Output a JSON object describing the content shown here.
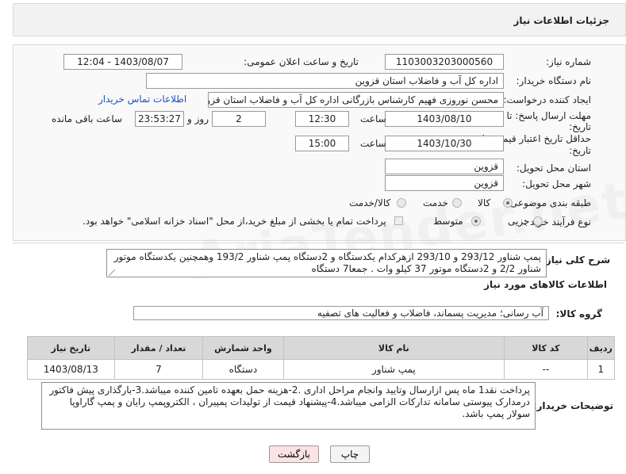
{
  "header": {
    "title": "جزئیات اطلاعات نیاز"
  },
  "form": {
    "need_number": {
      "label": "شماره نیاز:",
      "value": "1103003203000560"
    },
    "announce": {
      "label": "تاریخ و ساعت اعلان عمومی:",
      "value": "1403/08/07 - 12:04"
    },
    "buyer_org": {
      "label": "نام دستگاه خریدار:",
      "value": "اداره کل آب و فاضلاب استان قزوین"
    },
    "creator": {
      "label": "ایجاد کننده درخواست:",
      "value": "محسن نوروزی فهیم کارشناس بازرگانی اداره کل آب و فاضلاب استان قزوین",
      "contact_link": "اطلاعات تماس خریدار"
    },
    "deadline": {
      "label_line1": "مهلت ارسال پاسخ: تا",
      "label_line2": "تاریخ:",
      "date": "1403/08/10",
      "time_label": "ساعت",
      "time": "12:30",
      "days": "2",
      "days_label": "روز و",
      "remaining": "23:53:27",
      "remaining_label": "ساعت باقی مانده"
    },
    "price_validity": {
      "label_line1": "حداقل تاریخ اعتبار قیمت: تا",
      "label_line2": "تاریخ:",
      "date": "1403/10/30",
      "time_label": "ساعت",
      "time": "15:00"
    },
    "province": {
      "label": "استان محل تحویل:",
      "value": "قزوین"
    },
    "city": {
      "label": "شهر محل تحویل:",
      "value": "قزوین"
    },
    "category": {
      "label": "طبقه بندی موضوعی:",
      "options": [
        "کالا",
        "خدمت",
        "کالا/خدمت"
      ],
      "selected": "کالا"
    },
    "process": {
      "label": "نوع فرآیند خرید :",
      "options": [
        "جزیی",
        "متوسط"
      ],
      "selected": "متوسط",
      "payment_note": "پرداخت تمام یا بخشی از مبلغ خرید،از محل \"اسناد خزانه اسلامی\" خواهد بود."
    }
  },
  "summary": {
    "label": "شرح کلی نیاز:",
    "text": "پمپ شناور 293/12 و 293/10 ازهرکدام یکدستگاه و 2دستگاه پمپ شناور 193/2 وهمچنین یکدستگاه موتور شناور 2/2 و 2دستگاه موتور 37 کیلو وات . جمعا7 دستگاه"
  },
  "goods_section": {
    "title": "اطلاعات کالاهای مورد نیاز",
    "group_label": "گروه کالا:",
    "group_value": "آب رسانی؛ مدیریت پسماند، فاضلاب و فعالیت های تصفیه"
  },
  "table": {
    "headers": [
      "ردیف",
      "کد کالا",
      "نام کالا",
      "واحد شمارش",
      "تعداد / مقدار",
      "تاریخ نیاز"
    ],
    "rows": [
      [
        "1",
        "--",
        "پمپ شناور",
        "دستگاه",
        "7",
        "1403/08/13"
      ]
    ]
  },
  "buyer_notes": {
    "label": "توضیحات خریدار:",
    "text": "پرداخت نقد1 ماه پس ازارسال وتایید وانجام مراحل اداری .2-هزینه حمل بعهده تامین کننده میباشد.3-بارگذاری پیش فاکتور درمدارک پیوستی سامانه تدارکات الزامی میباشد.4-پیشنهاد قیمت از تولیدات  پمپیران ، الکتروپمپ رایان و پمپ گاراوپا سولار پمپ باشد."
  },
  "buttons": {
    "print": "چاپ",
    "back": "بازگشت"
  },
  "watermark": "AriaTender.net",
  "colors": {
    "link": "#1b53c4",
    "back_button_bg": "#fbe3e3",
    "header_bg": "#d8d8d8"
  }
}
